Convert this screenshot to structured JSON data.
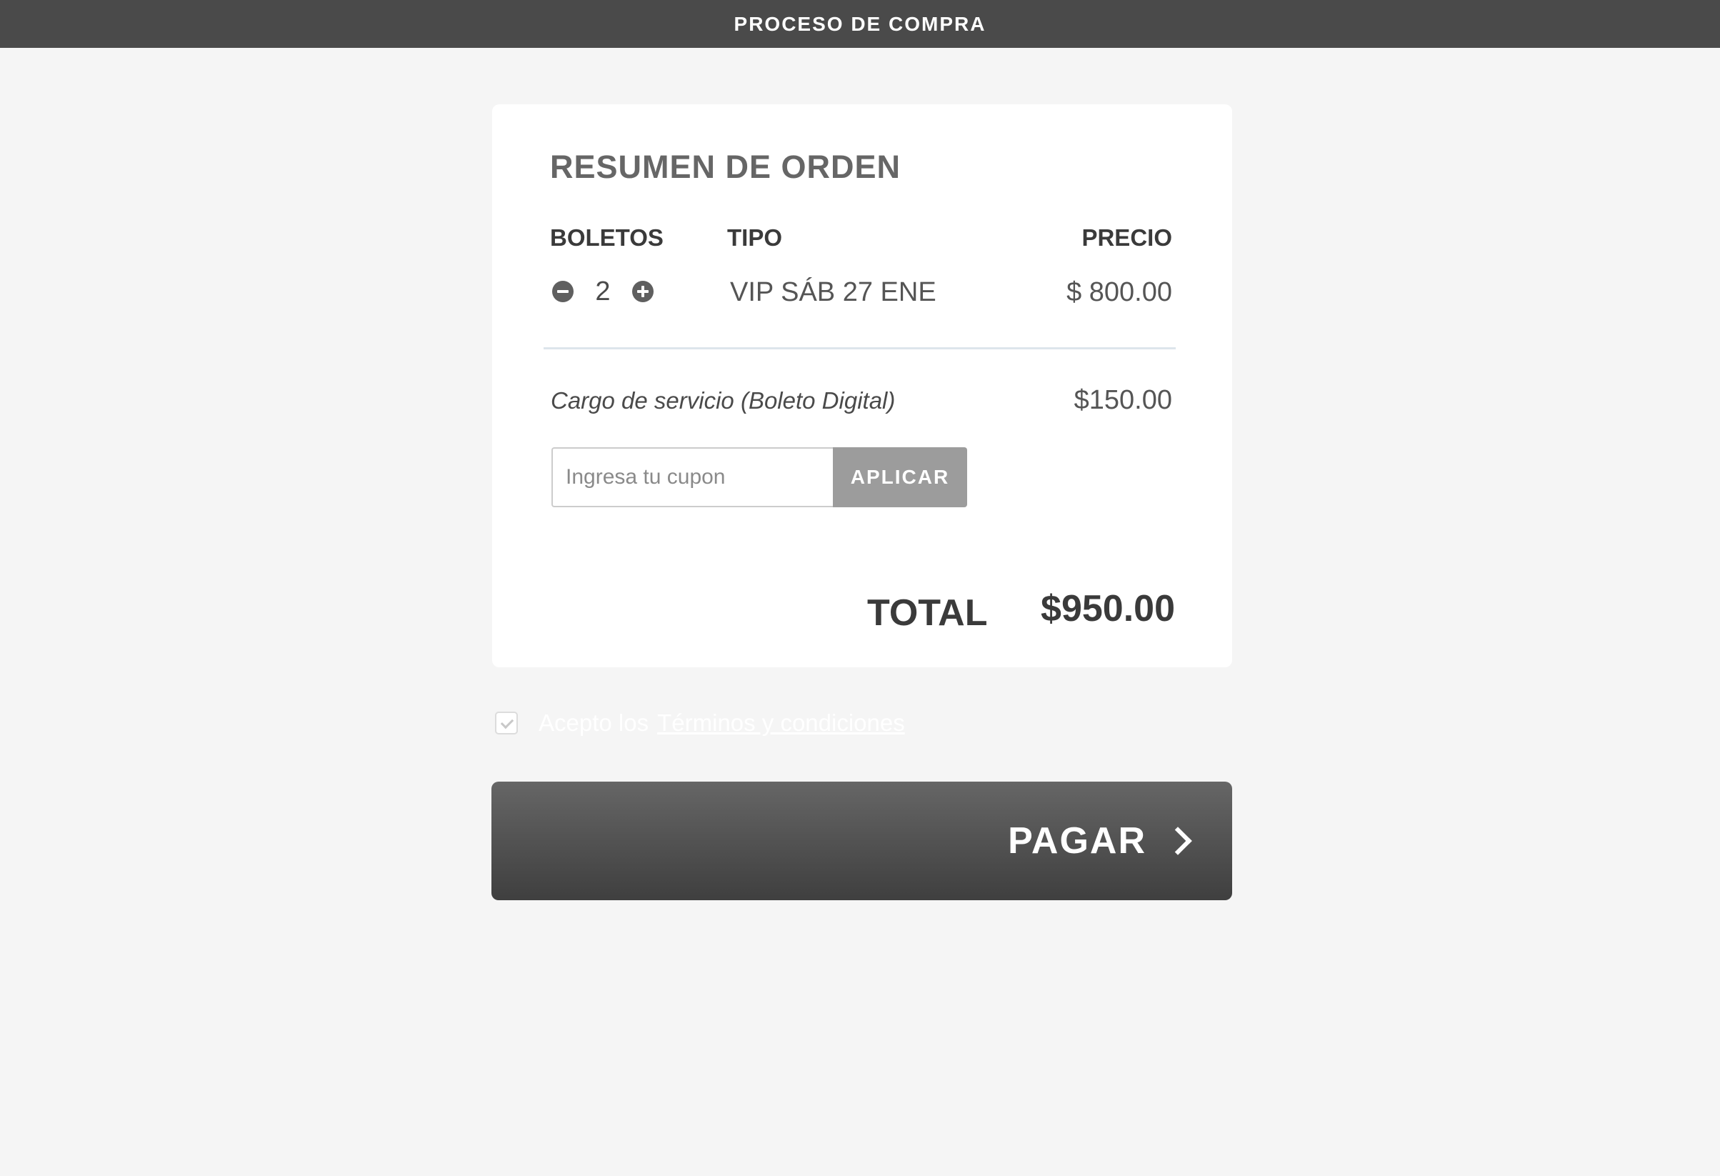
{
  "header": {
    "title": "PROCESO DE COMPRA"
  },
  "order": {
    "title": "RESUMEN DE ORDEN",
    "columns": {
      "tickets": "BOLETOS",
      "type": "TIPO",
      "price": "PRECIO"
    },
    "items": [
      {
        "quantity": "2",
        "type": "VIP SÁB 27 ENE",
        "price": "$ 800.00"
      }
    ],
    "service_fee": {
      "label": "Cargo de servicio (Boleto Digital)",
      "value": "$150.00"
    },
    "coupon": {
      "placeholder": "Ingresa tu cupon",
      "value": "",
      "button_label": "APLICAR"
    },
    "total": {
      "label": "TOTAL",
      "value": "$950.00"
    }
  },
  "terms": {
    "checked": true,
    "text": "Acepto los",
    "link_text": "Términos y condiciones"
  },
  "pay_button": {
    "label": "PAGAR"
  },
  "icons": {
    "decrease": "minus-circle-icon",
    "increase": "plus-circle-icon",
    "checkbox": "check-icon",
    "pay": "chevron-right-icon"
  },
  "colors": {
    "header_bg": "#4a4a4a",
    "page_bg": "#f5f5f5",
    "card_bg": "#ffffff",
    "apply_button_bg": "#9c9c9c",
    "pay_button_top": "#666666",
    "pay_button_bottom": "#3f3f3f"
  }
}
